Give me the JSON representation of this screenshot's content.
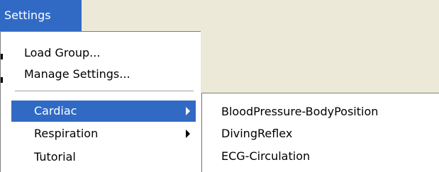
{
  "menubar": {
    "title": "Settings"
  },
  "menu": {
    "items": [
      {
        "label": "Load Group..."
      },
      {
        "label": "Manage Settings..."
      },
      {
        "label": "Cardiac",
        "submenu": true
      },
      {
        "label": "Respiration",
        "submenu": true
      },
      {
        "label": "Tutorial"
      }
    ]
  },
  "submenu": {
    "items": [
      {
        "label": "BloodPressure-BodyPosition"
      },
      {
        "label": "DivingReflex"
      },
      {
        "label": "ECG-Circulation"
      }
    ]
  },
  "colors": {
    "highlight": "#316ac5",
    "menu_bg": "#ffffff",
    "chrome": "#ece9d8"
  }
}
